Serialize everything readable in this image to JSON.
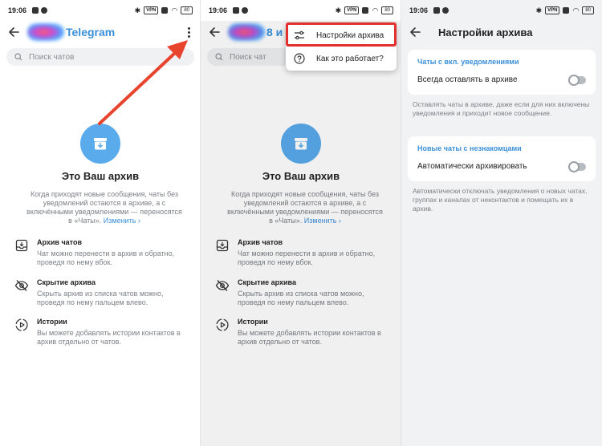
{
  "status": {
    "time": "19:06",
    "vpn": "VPN",
    "battery": "80"
  },
  "screen1": {
    "app_title": "Telegram",
    "search_placeholder": "Поиск чатов",
    "hero_title": "Это Ваш архив",
    "hero_desc": "Когда приходят новые сообщения, чаты без уведомлений остаются в архиве, а с включёнными уведомлениями — переносятся в «Чаты».",
    "hero_link": "Изменить ›",
    "features": [
      {
        "icon": "archive-down-icon",
        "title": "Архив чатов",
        "text": "Чат можно перенести в архив и обратно, проведя по нему вбок."
      },
      {
        "icon": "eye-off-icon",
        "title": "Скрытие архива",
        "text": "Скрыть архив из списка чатов можно, проведя по нему пальцем влево."
      },
      {
        "icon": "stories-icon",
        "title": "Истории",
        "text": "Вы можете добавлять истории контактов в архив отдельно от чатов."
      }
    ]
  },
  "screen2": {
    "app_title_partial": "8 и",
    "search_placeholder": "Поиск чат",
    "menu": [
      {
        "icon": "sliders-icon",
        "label": "Настройки архива"
      },
      {
        "icon": "question-icon",
        "label": "Как это работает?"
      }
    ]
  },
  "screen3": {
    "title": "Настройки архива",
    "section1_header": "Чаты с вкл. уведомлениями",
    "section1_row": "Всегда оставлять в архиве",
    "section1_hint": "Оставлять чаты в архиве, даже если для них включены уведомления и приходит новое сообщение.",
    "section2_header": "Новые чаты с незнакомцами",
    "section2_row": "Автоматически архивировать",
    "section2_hint": "Автоматически отключать уведомления о новых чатах, группах и каналах от неконтактов и помещать их в архив."
  },
  "colors": {
    "accent": "#3a8fd9",
    "hero_circle": "#5aabec",
    "annotation_arrow": "#e8432d",
    "highlight_box": "#e2302f",
    "settings_bg": "#f1f2f4"
  }
}
